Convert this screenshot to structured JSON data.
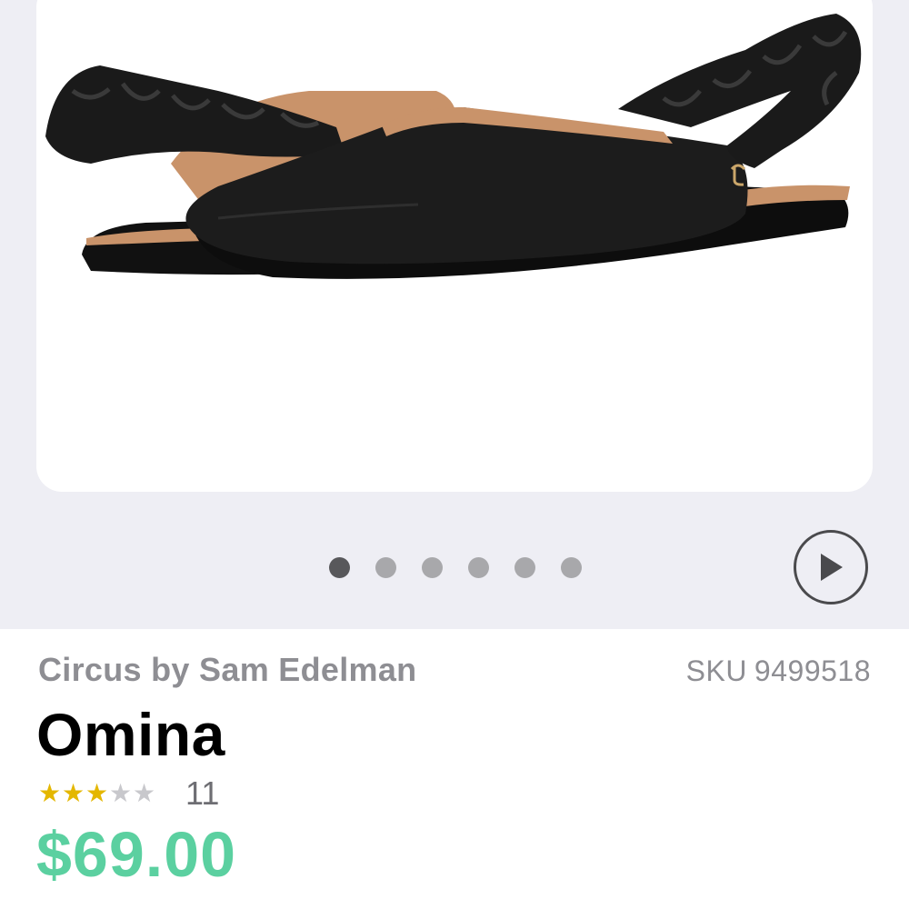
{
  "product": {
    "image_alt": "Black leather pointed-toe slingback flat with ruched elastic strap",
    "brand": "Circus by Sam Edelman",
    "sku_label": "SKU",
    "sku": "9499518",
    "name": "Omina",
    "rating": 3,
    "rating_max": 5,
    "review_count": "11",
    "price": "$69.00"
  },
  "gallery": {
    "image_count": 6,
    "active_index": 0
  },
  "colors": {
    "price": "#5bd0a0",
    "star_filled": "#e4b700",
    "star_empty": "#c8c8cc",
    "background": "#eeeef4"
  },
  "icons": {
    "play": "play-icon",
    "star": "star-icon"
  }
}
